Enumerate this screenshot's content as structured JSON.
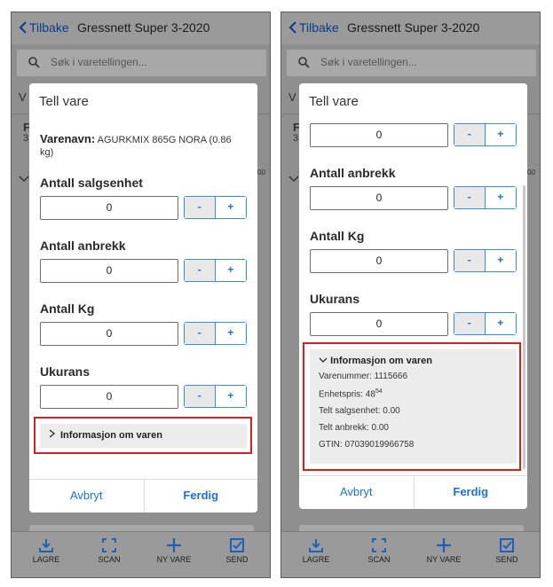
{
  "header": {
    "back_label": "Tilbake",
    "title": "Gressnett Super 3-2020"
  },
  "search": {
    "placeholder": "Søk i varetellingen..."
  },
  "background_hints": {
    "left_v": "V",
    "left_r": "F",
    "left_3": "3",
    "right_v": "V",
    "right_r": "F",
    "right_3": "3",
    "sup00": "00"
  },
  "modal": {
    "title": "Tell vare",
    "item_name_label": "Varenavn:",
    "item_name_value": "AGURKMIX 865G NORA (0.86 kg)",
    "fields": [
      {
        "label": "Antall salgsenhet",
        "value": "0"
      },
      {
        "label": "Antall anbrekk",
        "value": "0"
      },
      {
        "label": "Antall Kg",
        "value": "0"
      },
      {
        "label": "Ukurans",
        "value": "0"
      }
    ],
    "minus_label": "-",
    "plus_label": "+",
    "top_partial_value": "0",
    "info_title": "Informasjon om varen",
    "info": {
      "varenummer": "Varenummer: 1115666",
      "enhetspris_prefix": "Enhetspris: 48",
      "enhetspris_sup": "54",
      "telt_salgsenhet": "Telt salgsenhet: 0.00",
      "telt_anbrekk": "Telt anbrekk: 0.00",
      "gtin": "GTIN: 07039019966758"
    },
    "cancel_label": "Avbryt",
    "done_label": "Ferdig"
  },
  "bottom_nav": [
    {
      "label": "LAGRE",
      "icon": "save-icon"
    },
    {
      "label": "SCAN",
      "icon": "scan-icon"
    },
    {
      "label": "NY VARE",
      "icon": "plus-icon"
    },
    {
      "label": "SEND",
      "icon": "send-icon"
    }
  ],
  "colors": {
    "accent": "#1f6fd1",
    "highlight": "#d32020",
    "overlay": "#8f8f8f"
  }
}
